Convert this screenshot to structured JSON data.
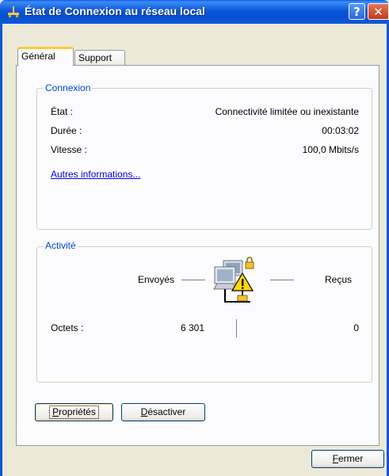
{
  "window": {
    "title": "État de Connexion au réseau local",
    "help_label": "?",
    "close_label": "✕"
  },
  "tabs": [
    {
      "label": "Général",
      "active": true
    },
    {
      "label": "Support",
      "active": false
    }
  ],
  "connexion": {
    "legend": "Connexion",
    "rows": [
      {
        "label": "État :",
        "value": "Connectivité limitée ou inexistante"
      },
      {
        "label": "Durée :",
        "value": "00:03:02"
      },
      {
        "label": "Vitesse :",
        "value": "100,0 Mbits/s"
      }
    ],
    "link": "Autres informations..."
  },
  "activite": {
    "legend": "Activité",
    "sent_label": "Envoyés",
    "received_label": "Reçus",
    "octets_label": "Octets :",
    "octets_sent": "6 301",
    "octets_received": "0",
    "icon": "network-warning-icon"
  },
  "buttons": {
    "proprietes_first": "P",
    "proprietes_rest": "ropriétés",
    "desactiver_first": "D",
    "desactiver_rest": "ésactiver",
    "fermer_first": "F",
    "fermer_rest": "ermer"
  },
  "colors": {
    "titlebar": "#0a57d8",
    "legend_text": "#0046d5",
    "link": "#0000ee",
    "active_tab_accent": "#ffc83c"
  }
}
